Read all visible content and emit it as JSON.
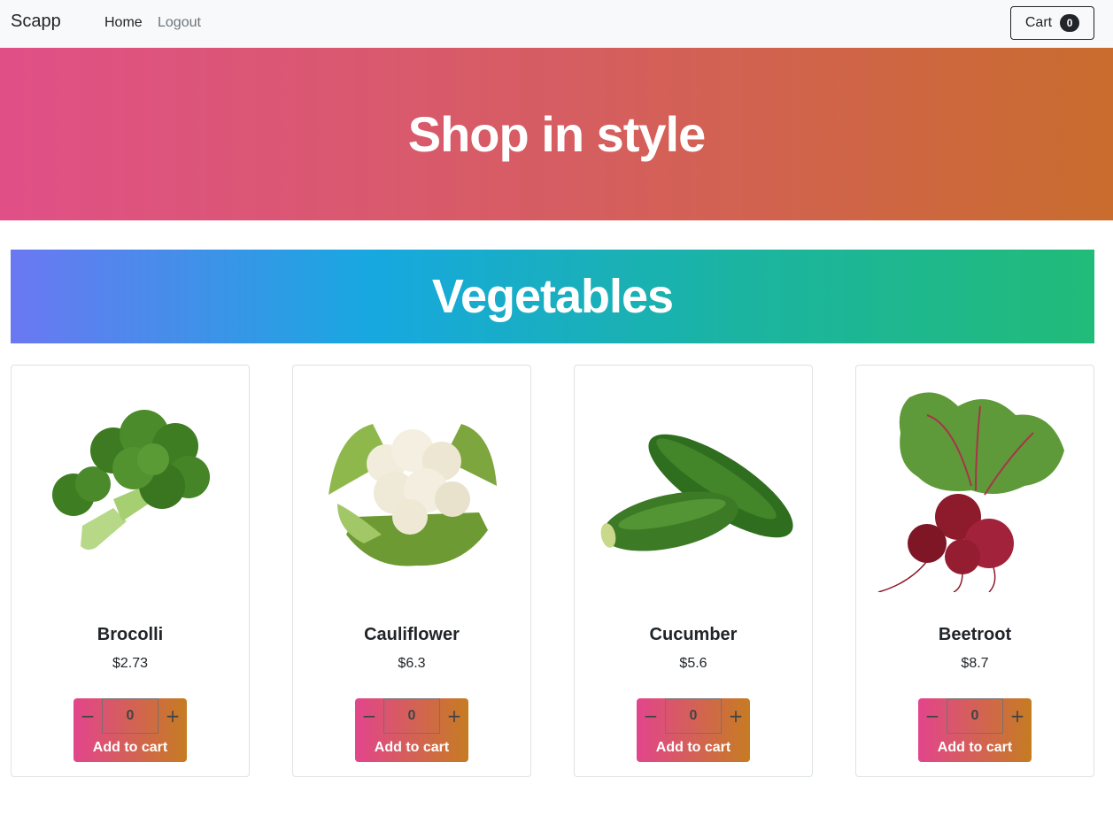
{
  "navbar": {
    "brand": "Scapp",
    "links": [
      {
        "label": "Home"
      },
      {
        "label": "Logout"
      }
    ],
    "cart_label": "Cart",
    "cart_count": "0"
  },
  "hero": {
    "title": "Shop in style"
  },
  "category": {
    "title": "Vegetables"
  },
  "products": [
    {
      "name": "Brocolli",
      "price": "$2.73",
      "quantity": "0",
      "minus": "−",
      "plus": "+",
      "add_label": "Add to cart",
      "image_icon": "broccoli-image"
    },
    {
      "name": "Cauliflower",
      "price": "$6.3",
      "quantity": "0",
      "minus": "−",
      "plus": "+",
      "add_label": "Add to cart",
      "image_icon": "cauliflower-image"
    },
    {
      "name": "Cucumber",
      "price": "$5.6",
      "quantity": "0",
      "minus": "−",
      "plus": "+",
      "add_label": "Add to cart",
      "image_icon": "cucumber-image"
    },
    {
      "name": "Beetroot",
      "price": "$8.7",
      "quantity": "0",
      "minus": "−",
      "plus": "+",
      "add_label": "Add to cart",
      "image_icon": "beetroot-image"
    }
  ],
  "colors": {
    "hero_gradient": [
      "#e05087",
      "#c96c2e"
    ],
    "category_gradient": [
      "#6b78f2",
      "#17a8e0",
      "#21bb79"
    ],
    "button_gradient": [
      "#e2458c",
      "#c67c22"
    ]
  }
}
